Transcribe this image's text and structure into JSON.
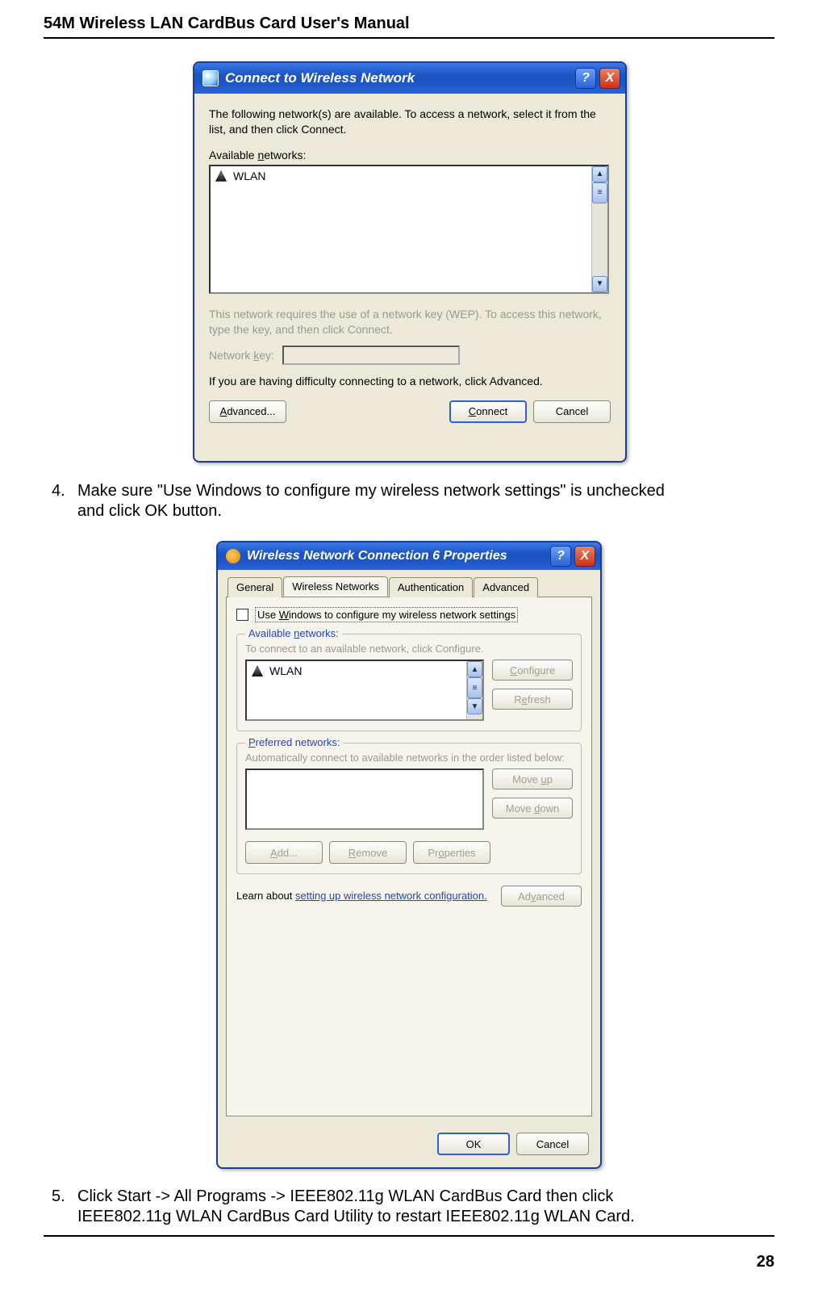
{
  "page": {
    "header": "54M Wireless LAN CardBus Card User's Manual",
    "number": "28"
  },
  "step4": {
    "number": "4.",
    "text": "Make sure \"Use Windows to configure my wireless network settings\" is unchecked and click OK button."
  },
  "step5": {
    "number": "5.",
    "text": "Click Start -> All Programs -> IEEE802.11g WLAN CardBus Card then click IEEE802.11g WLAN CardBus Card Utility to restart IEEE802.11g WLAN Card."
  },
  "dlg1": {
    "title": "Connect to Wireless Network",
    "help": "?",
    "close": "X",
    "msg": "The following network(s) are available. To access a network, select it from the list, and then click Connect.",
    "available_label_pre": "Available ",
    "available_label_ul": "n",
    "available_label_post": "etworks:",
    "network_item": "WLAN",
    "wep_msg": "This network requires the use of a network key (WEP). To access this network, type the key, and then click Connect.",
    "nk_label_pre": "Network ",
    "nk_label_ul": "k",
    "nk_label_post": "ey:",
    "difficulty": "If you are having difficulty connecting to a network, click Advanced.",
    "advanced_pre": "",
    "advanced_ul": "A",
    "advanced_post": "dvanced...",
    "connect_ul": "C",
    "connect_post": "onnect",
    "cancel": "Cancel",
    "scroll_up": "▲",
    "scroll_bars": "≡",
    "scroll_down": "▼"
  },
  "dlg2": {
    "title": "Wireless Network Connection 6 Properties",
    "help": "?",
    "close": "X",
    "tabs": {
      "general": "General",
      "wireless": "Wireless Networks",
      "auth": "Authentication",
      "adv": "Advanced"
    },
    "checkbox_pre": "Use ",
    "checkbox_ul": "W",
    "checkbox_post": "indows to configure my wireless network settings",
    "group_available_pre": "Available ",
    "group_available_ul": "n",
    "group_available_post": "etworks:",
    "available_hint": "To connect to an available network, click Configure.",
    "network_item": "WLAN",
    "configure_ul": "C",
    "configure_post": "onfigure",
    "refresh_pre": "R",
    "refresh_ul": "e",
    "refresh_post": "fresh",
    "group_preferred_ul": "P",
    "group_preferred_post": "referred networks:",
    "preferred_hint": "Automatically connect to available networks in the order listed below:",
    "moveup_pre": "Move ",
    "moveup_ul": "u",
    "moveup_post": "p",
    "movedown_pre": "Move ",
    "movedown_ul": "d",
    "movedown_post": "own",
    "add_ul": "A",
    "add_post": "dd...",
    "remove_ul": "R",
    "remove_post": "emove",
    "properties_pre": "Pr",
    "properties_ul": "o",
    "properties_post": "perties",
    "learn_pre": "Learn about ",
    "learn_link": "setting up wireless network configuration.",
    "advanced2_pre": "Ad",
    "advanced2_ul": "v",
    "advanced2_post": "anced",
    "ok": "OK",
    "cancel": "Cancel",
    "scroll_up": "▲",
    "scroll_bars": "≡",
    "scroll_down": "▼"
  }
}
